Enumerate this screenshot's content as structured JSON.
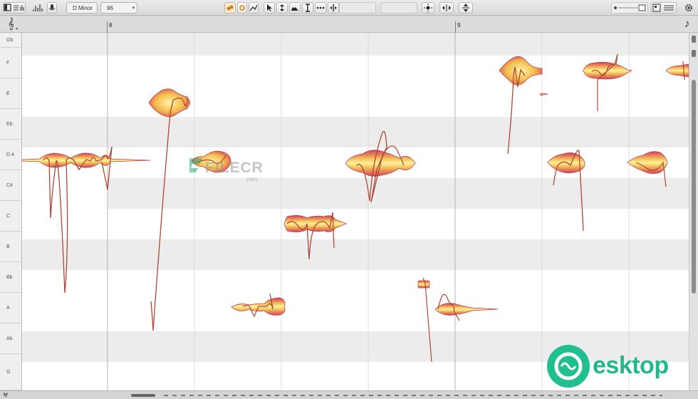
{
  "toolbar": {
    "key_signature": "D Minor",
    "tempo": "96",
    "icons": [
      "sidebar-toggle-icon",
      "mixer-icon",
      "waveform-icon",
      "microphone-icon",
      "macro-pitch-icon",
      "record-icon",
      "pitch-drift-icon",
      "pointer-tool-icon",
      "pitch-tool-icon",
      "formant-tool-icon",
      "amplitude-tool-icon",
      "timing-tool-icon",
      "separation-tool-icon",
      "brightness-icon",
      "quantize-icon",
      "split-icon",
      "settings-icon",
      "zoom-slider-icon",
      "inspector-icon"
    ]
  },
  "ruler": {
    "bars": [
      "8",
      "9"
    ],
    "clef_icon": "treble-clef-icon",
    "note_icon": "note-value-icon"
  },
  "pitch_rows": [
    "Gb",
    "F",
    "E",
    "Eb",
    "D 4",
    "C#",
    "C",
    "B",
    "Bb",
    "A",
    "Ab",
    "G"
  ],
  "watermarks": {
    "filecr_text": "FILECR",
    "filecr_domain": ".com",
    "desktop_text": "esktop"
  },
  "colors": {
    "blob_light": "#fff2a0",
    "blob_mid": "#f2b23a",
    "blob_dark": "#c9344e",
    "pitch_curve": "#b04636",
    "accent_record": "#e07a10"
  }
}
